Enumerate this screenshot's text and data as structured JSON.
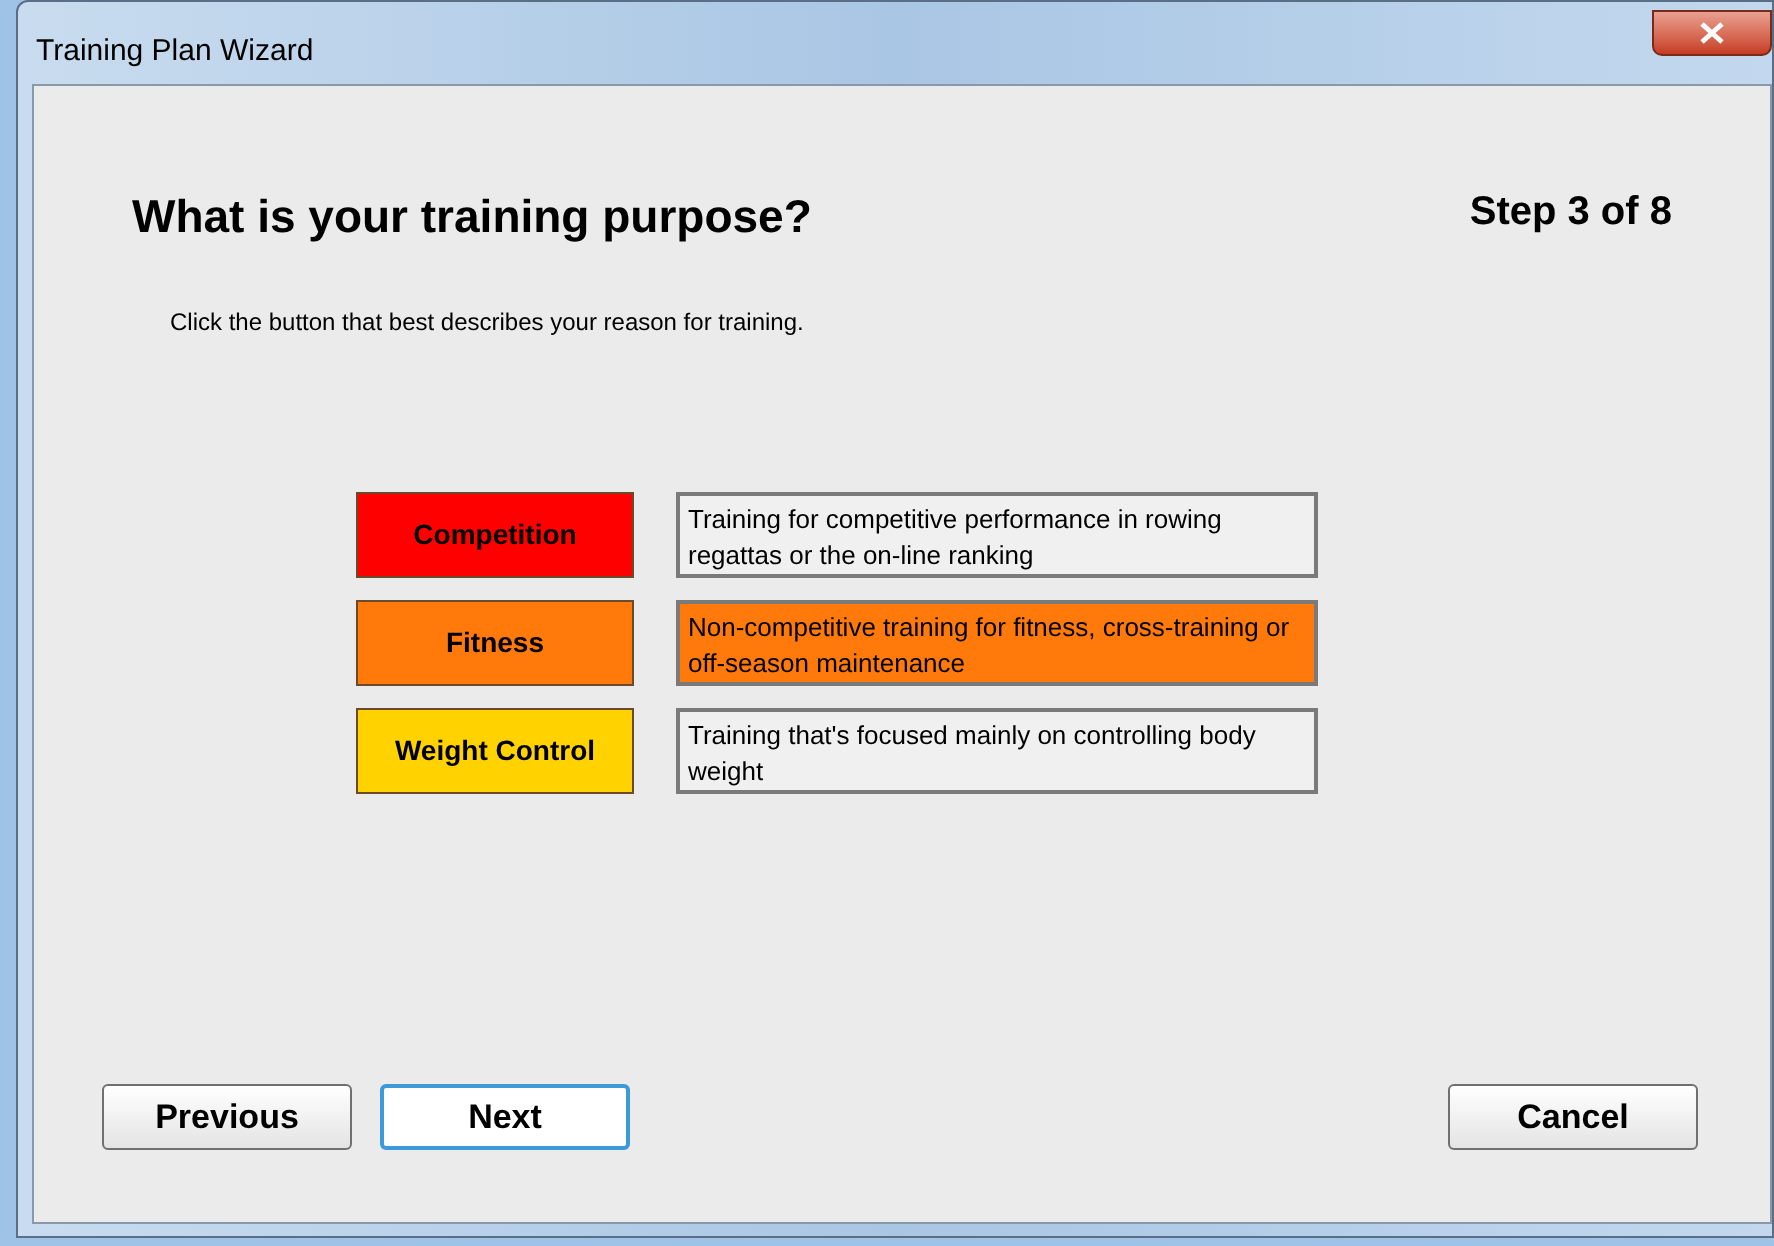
{
  "window": {
    "title": "Training Plan Wizard"
  },
  "heading": "What is your training purpose?",
  "step": "Step 3 of 8",
  "instruction": "Click the button that best describes your reason for training.",
  "options": [
    {
      "label": "Competition",
      "description": "Training for competitive performance in rowing regattas or the on-line ranking",
      "color": "#ff0000",
      "selected": false
    },
    {
      "label": "Fitness",
      "description": "Non-competitive training for fitness, cross-training or off-season maintenance",
      "color": "#ff7a0a",
      "selected": true
    },
    {
      "label": "Weight Control",
      "description": "Training that's focused mainly on controlling body weight",
      "color": "#ffd200",
      "selected": false
    }
  ],
  "buttons": [
    {
      "label": "Previous",
      "focused": false
    },
    {
      "label": "Next",
      "focused": true
    },
    {
      "label": "Cancel",
      "focused": false
    }
  ]
}
